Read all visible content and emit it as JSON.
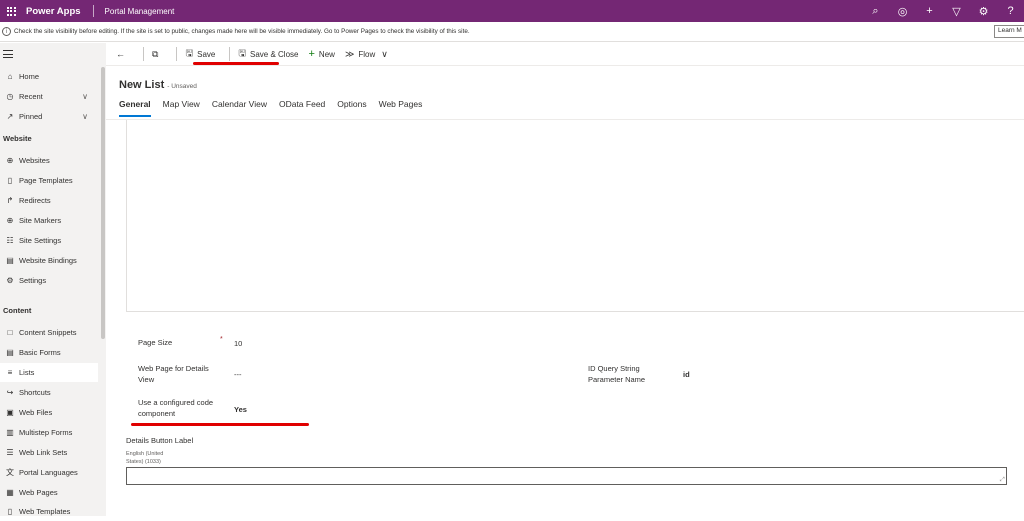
{
  "topbar": {
    "app_name": "Power Apps",
    "environment": "Portal Management",
    "icons": [
      "search-icon",
      "target-icon",
      "add-icon",
      "filter-icon",
      "settings-icon",
      "help-icon"
    ]
  },
  "notice": {
    "text": "Check the site visibility before editing. If the site is set to public, changes made here will be visible immediately. Go to Power Pages to check the visibility of this site.",
    "learn_more": "Learn M"
  },
  "sidebar": {
    "top_items": [
      {
        "label": "Home",
        "icon": "home-icon"
      },
      {
        "label": "Recent",
        "icon": "clock-icon"
      },
      {
        "label": "Pinned",
        "icon": "pin-icon"
      }
    ],
    "website_section": "Website",
    "website_items": [
      {
        "label": "Websites",
        "icon": "globe-icon"
      },
      {
        "label": "Page Templates",
        "icon": "page-icon"
      },
      {
        "label": "Redirects",
        "icon": "redirect-icon"
      },
      {
        "label": "Site Markers",
        "icon": "marker-icon"
      },
      {
        "label": "Site Settings",
        "icon": "settings-list-icon"
      },
      {
        "label": "Website Bindings",
        "icon": "binding-icon"
      },
      {
        "label": "Settings",
        "icon": "gear-icon"
      }
    ],
    "content_section": "Content",
    "content_items": [
      {
        "label": "Content Snippets",
        "icon": "snippet-icon"
      },
      {
        "label": "Basic Forms",
        "icon": "form-icon"
      },
      {
        "label": "Lists",
        "icon": "list-icon"
      },
      {
        "label": "Shortcuts",
        "icon": "shortcut-icon"
      },
      {
        "label": "Web Files",
        "icon": "file-icon"
      },
      {
        "label": "Multistep Forms",
        "icon": "multistep-icon"
      },
      {
        "label": "Web Link Sets",
        "icon": "link-set-icon"
      },
      {
        "label": "Portal Languages",
        "icon": "language-icon"
      },
      {
        "label": "Web Pages",
        "icon": "webpage-icon"
      },
      {
        "label": "Web Templates",
        "icon": "template-icon"
      }
    ]
  },
  "commandbar": {
    "save": "Save",
    "save_close": "Save & Close",
    "new": "New",
    "flow": "Flow"
  },
  "record": {
    "title": "New List",
    "status": "- Unsaved"
  },
  "tabs": [
    "General",
    "Map View",
    "Calendar View",
    "OData Feed",
    "Options",
    "Web Pages"
  ],
  "form": {
    "page_size_label": "Page Size",
    "page_size_value": "10",
    "details_view_label_1": "Web Page for Details",
    "details_view_label_2": "View",
    "details_view_value": "---",
    "id_query_label_1": "ID Query String",
    "id_query_label_2": "Parameter Name",
    "id_query_value": "id",
    "code_component_label_1": "Use a configured code",
    "code_component_label_2": "component",
    "code_component_value": "Yes",
    "details_button_label": "Details Button Label",
    "lang_line_1": "English (United",
    "lang_line_2": "States) (1033)",
    "details_button_value": ""
  },
  "colors": {
    "topbar": "#742774",
    "accent": "#0078d4",
    "annotation": "#e00000"
  }
}
